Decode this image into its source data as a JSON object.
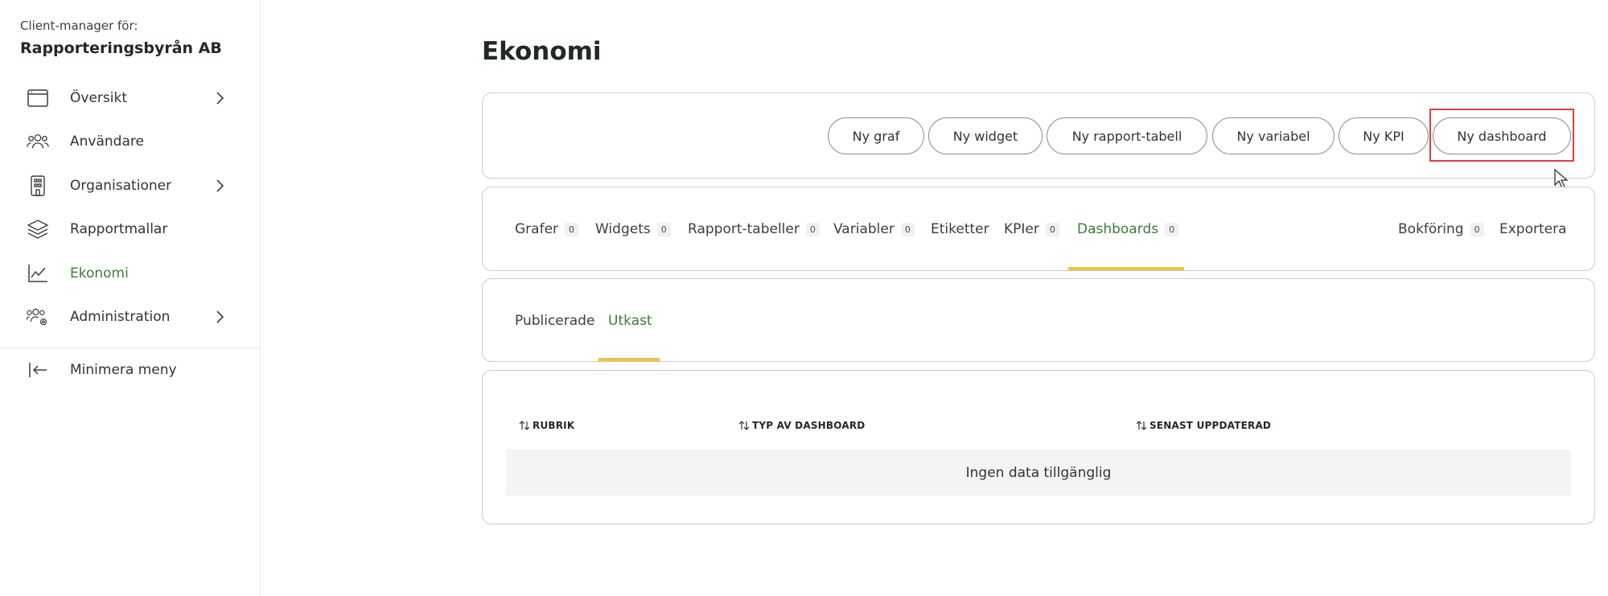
{
  "sidebar": {
    "client_label": "Client-manager för:",
    "client_name": "Rapporteringsbyrån AB",
    "items": [
      {
        "label": "Översikt",
        "icon": "browser-window-icon",
        "chevron": true,
        "active": false
      },
      {
        "label": "Användare",
        "icon": "users-icon",
        "chevron": false,
        "active": false
      },
      {
        "label": "Organisationer",
        "icon": "building-icon",
        "chevron": true,
        "active": false
      },
      {
        "label": "Rapportmallar",
        "icon": "layers-icon",
        "chevron": false,
        "active": false
      },
      {
        "label": "Ekonomi",
        "icon": "line-chart-icon",
        "chevron": false,
        "active": true
      },
      {
        "label": "Administration",
        "icon": "users-gear-icon",
        "chevron": true,
        "active": false
      }
    ],
    "minimize_label": "Minimera meny"
  },
  "main": {
    "title": "Ekonomi",
    "toolbar": {
      "buttons": [
        "Ny graf",
        "Ny widget",
        "Ny rapport-tabell",
        "Ny variabel",
        "Ny KPI",
        "Ny dashboard"
      ]
    },
    "tabs": [
      {
        "label": "Grafer",
        "count": "0"
      },
      {
        "label": "Widgets",
        "count": "0"
      },
      {
        "label": "Rapport-tabeller",
        "count": "0"
      },
      {
        "label": "Variabler",
        "count": "0"
      },
      {
        "label": "Etiketter"
      },
      {
        "label": "KPIer",
        "count": "0"
      },
      {
        "label": "Dashboards",
        "count": "0",
        "active": true
      },
      {
        "label": "Bokföring",
        "count": "0"
      },
      {
        "label": "Exportera"
      }
    ],
    "subtabs": [
      {
        "label": "Publicerade"
      },
      {
        "label": "Utkast",
        "active": true
      }
    ],
    "table": {
      "columns": [
        "RUBRIK",
        "TYP AV DASHBOARD",
        "SENAST UPPDATERAD"
      ],
      "empty_text": "Ingen data tillgänglig"
    }
  },
  "colors": {
    "accent_green": "#3f7a3a",
    "tab_underline": "#f0c23b",
    "highlight_red": "#e53c3c",
    "border": "#c9ccca"
  }
}
